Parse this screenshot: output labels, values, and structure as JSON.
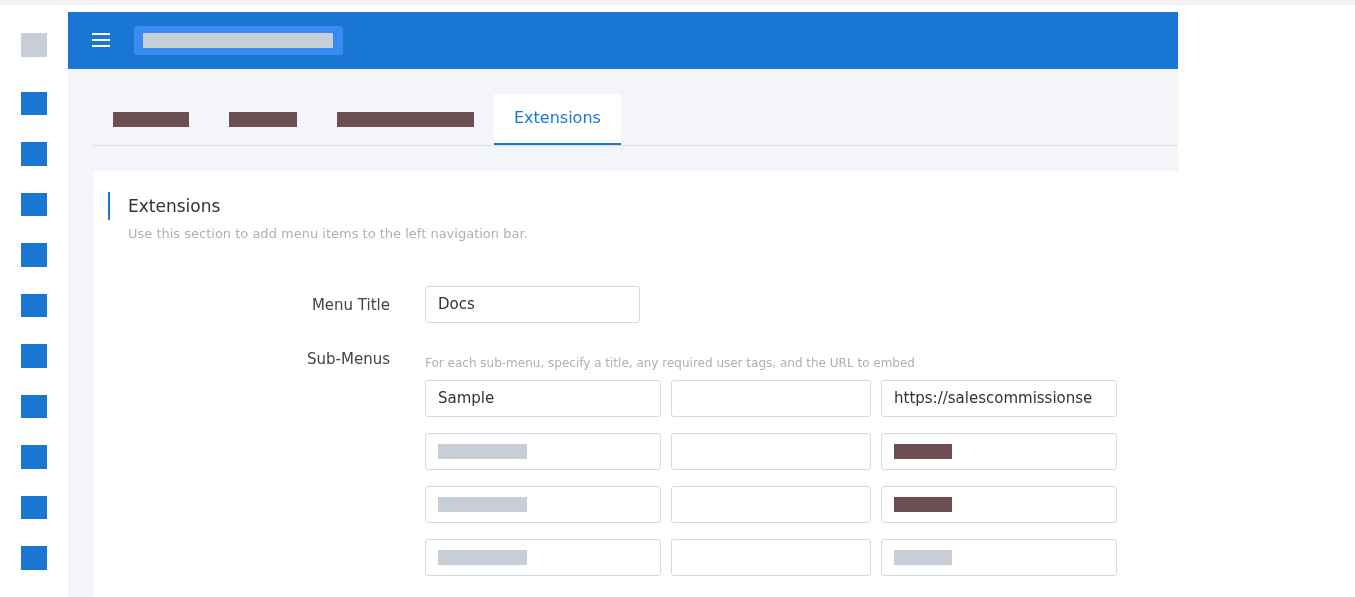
{
  "header": {
    "color": "#c8ced5"
  },
  "tabs": [
    {
      "color": "#6b4f53",
      "selected": false
    },
    {
      "color": "#6b4f53",
      "selected": false
    },
    {
      "color": "#6b4f53",
      "selected": false
    },
    {
      "label": "Extensions",
      "selected": true
    }
  ],
  "section": {
    "title": "Extensions",
    "description": "Use this section to add menu items to the left navigation bar."
  },
  "menu_title": {
    "label": "Menu Title",
    "value": "Docs"
  },
  "sub_menus": {
    "label": "Sub-Menus",
    "hint": "For each sub-menu, specify a title, any required user tags, and the URL to embed",
    "rows": [
      [
        {
          "value": "Sample"
        },
        {},
        {
          "value": "https://salescommissionse"
        }
      ],
      [
        {
          "color": "#c8ced5"
        },
        {},
        {
          "color": "#6b4f53"
        }
      ],
      [
        {
          "color": "#c8ced5"
        },
        {},
        {
          "color": "#6b4f53"
        }
      ],
      [
        {
          "color": "#c8ced5"
        },
        {},
        {
          "color": "#c8ced5"
        }
      ]
    ]
  }
}
